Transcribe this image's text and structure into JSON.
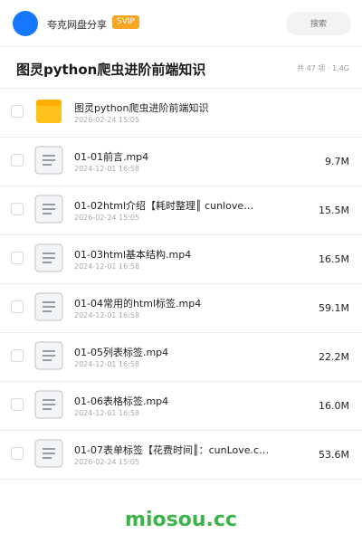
{
  "header": {
    "sharer_name": "夸克网盘分享",
    "badge": "SVIP",
    "search_placeholder": "搜索"
  },
  "folder": {
    "title": "图灵python爬虫进阶前端知识",
    "summary": "共 47 项 · 1.4G"
  },
  "files": [
    {
      "name": "图灵python爬虫进阶前端知识",
      "date": "2026-02-24 15:05",
      "size": "",
      "icon": "folder-icon"
    },
    {
      "name": "01-01前言.mp4",
      "date": "2024-12-01 16:58",
      "size": "9.7M",
      "icon": "video-file-icon"
    },
    {
      "name": "01-02html介绍【耗时整理║ cunlove…",
      "date": "2026-02-24 15:05",
      "size": "15.5M",
      "icon": "video-file-icon"
    },
    {
      "name": "01-03html基本结构.mp4",
      "date": "2024-12-01 16:58",
      "size": "16.5M",
      "icon": "video-file-icon"
    },
    {
      "name": "01-04常用的html标签.mp4",
      "date": "2024-12-01 16:58",
      "size": "59.1M",
      "icon": "video-file-icon"
    },
    {
      "name": "01-05列表标签.mp4",
      "date": "2024-12-01 16:58",
      "size": "22.2M",
      "icon": "video-file-icon"
    },
    {
      "name": "01-06表格标签.mp4",
      "date": "2024-12-01 16:58",
      "size": "16.0M",
      "icon": "video-file-icon"
    },
    {
      "name": "01-07表单标签【花费时间║：cunLove.c…",
      "date": "2026-02-24 15:05",
      "size": "53.6M",
      "icon": "video-file-icon"
    }
  ],
  "watermark": "miosou.cc",
  "colors": {
    "accent": "#1677ff",
    "svip": "#f5a623",
    "folder": "#ffc21a",
    "watermark": "#3cb44b"
  }
}
